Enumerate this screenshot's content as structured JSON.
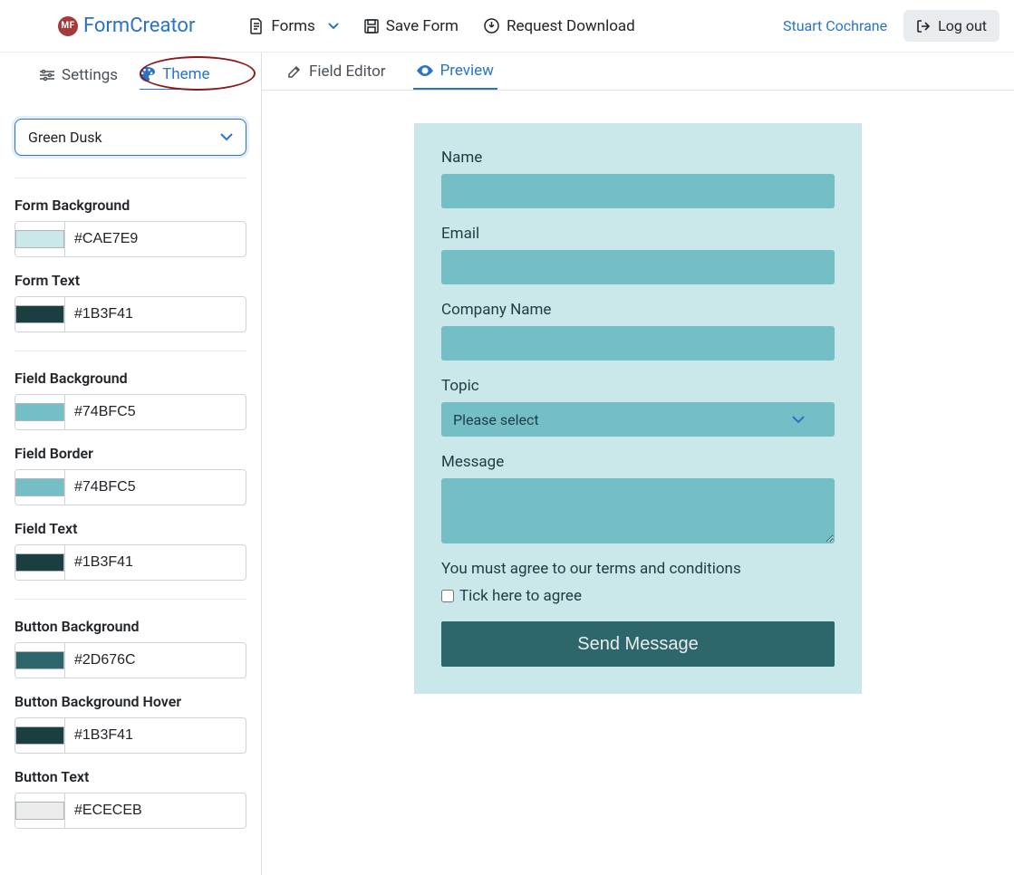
{
  "brand": {
    "badge": "MF",
    "name": "FormCreator"
  },
  "topnav": {
    "forms": "Forms",
    "save": "Save Form",
    "download": "Request Download",
    "user": "Stuart Cochrane",
    "logout": "Log out"
  },
  "sidebar_tabs": {
    "settings": "Settings",
    "theme": "Theme"
  },
  "theme_select": {
    "value": "Green Dusk"
  },
  "colors": {
    "form_bg": {
      "label": "Form Background",
      "hex": "#CAE7E9"
    },
    "form_text": {
      "label": "Form Text",
      "hex": "#1B3F41"
    },
    "field_bg": {
      "label": "Field Background",
      "hex": "#74BFC5"
    },
    "field_border": {
      "label": "Field Border",
      "hex": "#74BFC5"
    },
    "field_text": {
      "label": "Field Text",
      "hex": "#1B3F41"
    },
    "button_bg": {
      "label": "Button Background",
      "hex": "#2D676C"
    },
    "button_bg_hover": {
      "label": "Button Background Hover",
      "hex": "#1B3F41"
    },
    "button_text": {
      "label": "Button Text",
      "hex": "#ECECEB"
    }
  },
  "content_tabs": {
    "editor": "Field Editor",
    "preview": "Preview"
  },
  "form": {
    "name_label": "Name",
    "email_label": "Email",
    "company_label": "Company Name",
    "topic_label": "Topic",
    "topic_placeholder": "Please select",
    "message_label": "Message",
    "terms_text": "You must agree to our terms and conditions",
    "tick_label": "Tick here to agree",
    "submit_label": "Send Message"
  }
}
